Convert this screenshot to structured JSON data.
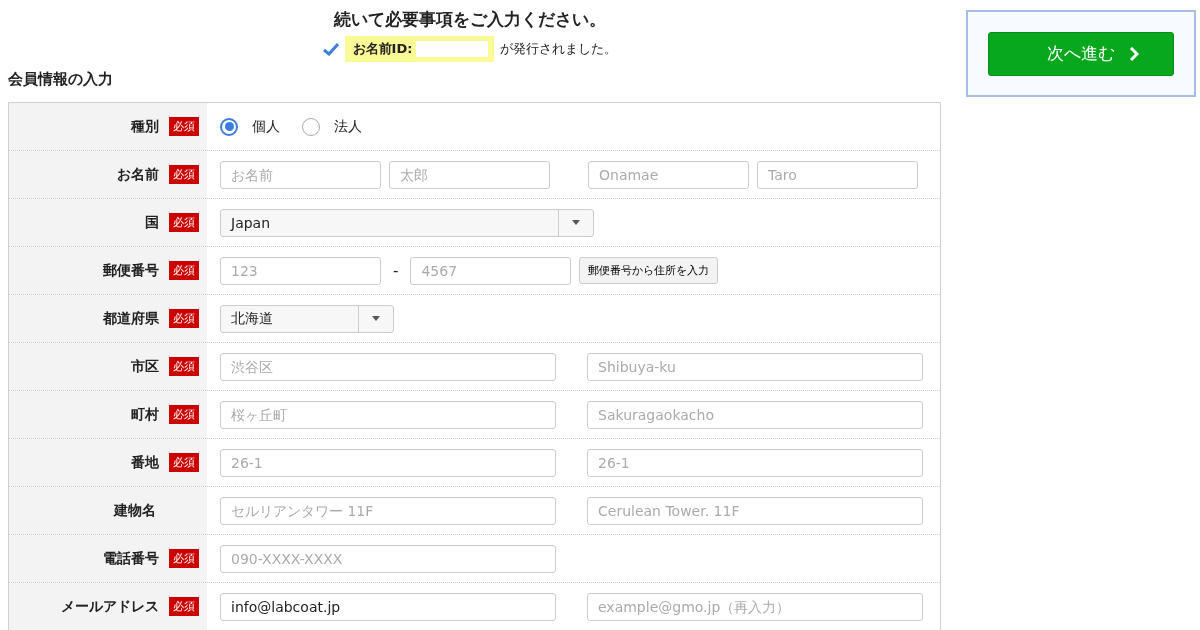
{
  "heading": "続いて必要事項をご入力ください。",
  "notice": {
    "label": "お名前ID:",
    "text": "が発行されました。"
  },
  "section_title": "会員情報の入力",
  "next_button": {
    "label": "次へ進む"
  },
  "rows": [
    {
      "kind": "radio",
      "label": "種別",
      "badge": "必須",
      "options": [
        {
          "label": "個人",
          "selected": true
        },
        {
          "label": "法人",
          "selected": false
        }
      ]
    },
    {
      "kind": "name",
      "label": "お名前",
      "badge": "必須",
      "fields": [
        {
          "placeholder": "お名前"
        },
        {
          "placeholder": "太郎"
        },
        {
          "placeholder": "Onamae"
        },
        {
          "placeholder": "Taro"
        }
      ]
    },
    {
      "kind": "select",
      "label": "国",
      "badge": "必須",
      "value": "Japan"
    },
    {
      "kind": "postal",
      "label": "郵便番号",
      "badge": "必須",
      "fields": [
        {
          "placeholder": "123"
        },
        {
          "placeholder": "4567"
        }
      ],
      "separator": "-",
      "button": "郵便番号から住所を入力"
    },
    {
      "kind": "shortselect",
      "label": "都道府県",
      "badge": "必須",
      "value": "北海道"
    },
    {
      "kind": "pair",
      "label": "市区",
      "badge": "必須",
      "fields": [
        {
          "placeholder": "渋谷区"
        },
        {
          "placeholder": "Shibuya-ku"
        }
      ]
    },
    {
      "kind": "pair",
      "label": "町村",
      "badge": "必須",
      "fields": [
        {
          "placeholder": "桜ヶ丘町"
        },
        {
          "placeholder": "Sakuragaokacho"
        }
      ]
    },
    {
      "kind": "pair",
      "label": "番地",
      "badge": "必須",
      "fields": [
        {
          "placeholder": "26-1"
        },
        {
          "placeholder": "26-1"
        }
      ]
    },
    {
      "kind": "pair",
      "label": "建物名",
      "fields": [
        {
          "placeholder": "セルリアンタワー 11F"
        },
        {
          "placeholder": "Cerulean Tower. 11F"
        }
      ]
    },
    {
      "kind": "single",
      "label": "電話番号",
      "badge": "必須",
      "fields": [
        {
          "placeholder": "090-XXXX-XXXX"
        }
      ]
    },
    {
      "kind": "pair",
      "label": "メールアドレス",
      "badge": "必須",
      "fields": [
        {
          "value": "info@labcoat.jp"
        },
        {
          "placeholder": "example@gmo.jp（再入力）"
        }
      ]
    }
  ]
}
